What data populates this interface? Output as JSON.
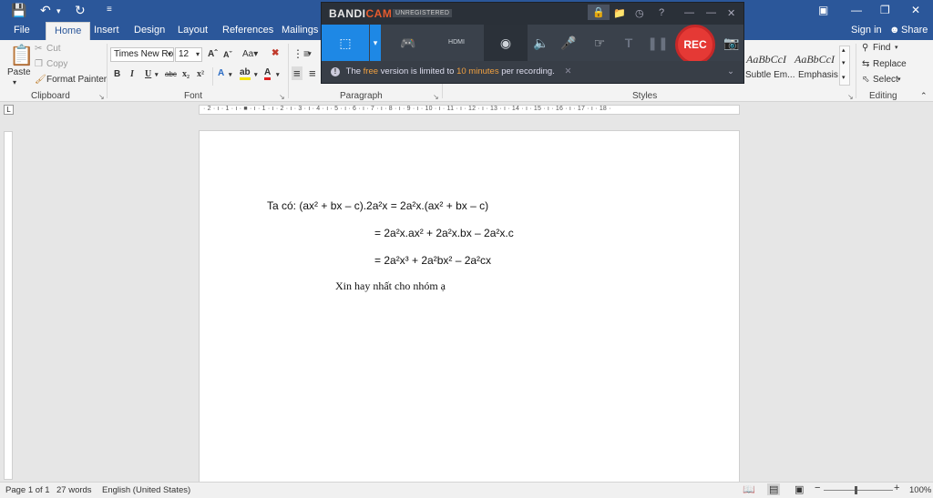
{
  "titlebar": {
    "save_icon": "save-icon",
    "undo_icon": "undo-icon",
    "redo_icon": "redo-icon",
    "customize_icon": "customize-quick-access-icon"
  },
  "tabs": [
    "File",
    "Home",
    "Insert",
    "Design",
    "Layout",
    "References",
    "Mailings"
  ],
  "account": {
    "sign_in": "Sign in",
    "share": "Share"
  },
  "ribbon": {
    "clipboard": {
      "paste": "Paste",
      "cut": "Cut",
      "copy": "Copy",
      "format_painter": "Format Painter",
      "label": "Clipboard"
    },
    "font": {
      "family": "Times New Ro",
      "size": "12",
      "label": "Font"
    },
    "paragraph": {
      "label": "Paragraph"
    },
    "styles": {
      "label": "Styles",
      "items": [
        {
          "sample": "AaBbCcI",
          "name": "Subtle Em..."
        },
        {
          "sample": "AaBbCcI",
          "name": "Emphasis"
        }
      ]
    },
    "editing": {
      "find": "Find",
      "replace": "Replace",
      "select": "Select",
      "label": "Editing"
    }
  },
  "bandicam": {
    "logo_a": "BANDI",
    "logo_b": "CAM",
    "unregistered": "UNREGISTERED",
    "hdmi": "HDMI",
    "rec": "REC",
    "notice_pre": "The ",
    "notice_free": "free",
    "notice_mid": " version is limited to ",
    "notice_time": "10 minutes",
    "notice_post": " per recording."
  },
  "ruler": {
    "ticks": "· 2 · ı · 1 · ı · ■ · ı · 1 · ı · 2 · ı · 3 · ı · 4 · ı · 5 · ı · 6 · ı · 7 · ı · 8 · ı · 9 · ı · 10 · ı · 11 · ı · 12 · ı · 13 · ı · 14 · ı · 15 · ı · 16 · ı · 17 · ı · 18 ·"
  },
  "document": {
    "line1": "Ta có: (ax² + bx – c).2a²x = 2a²x.(ax² + bx – c)",
    "line2": "= 2a²x.ax² + 2a²x.bx – 2a²x.c",
    "line3": "= 2a²x³ + 2a²bx² – 2a²cx",
    "line4": "Xin hay nhất cho nhóm ạ"
  },
  "status": {
    "page": "Page 1 of 1",
    "words": "27 words",
    "language": "English (United States)",
    "zoom": "100%"
  },
  "colors": {
    "word_blue": "#2b579a",
    "bandicam_blue": "#1e88e5",
    "rec_red": "#e53935"
  }
}
